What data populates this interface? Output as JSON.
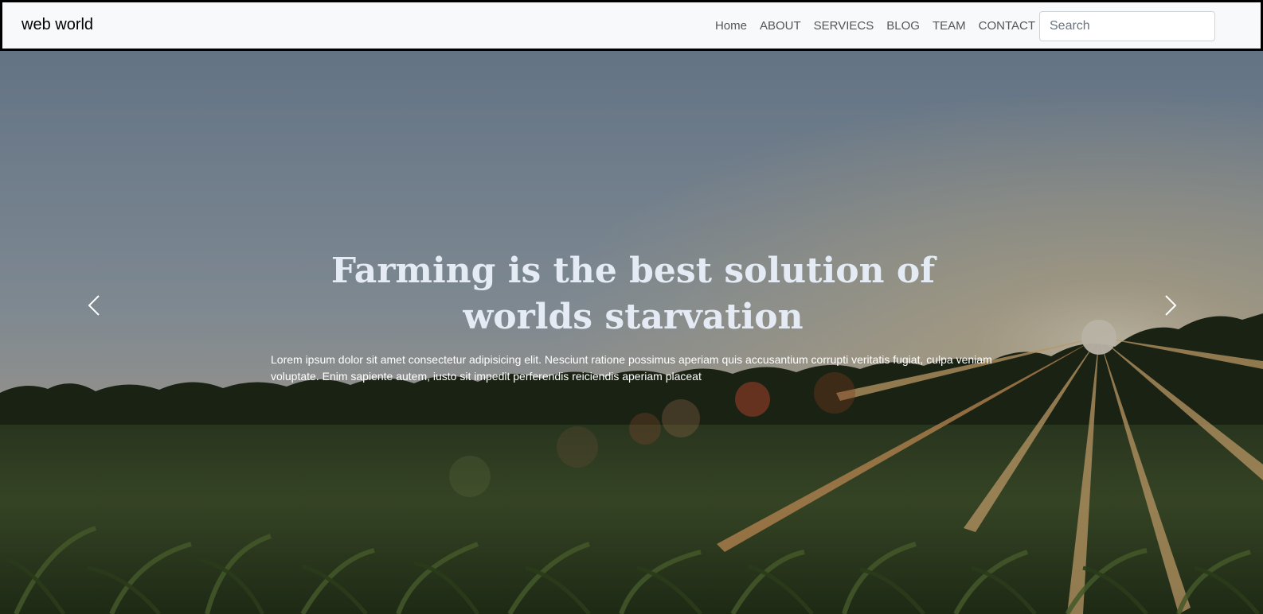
{
  "navbar": {
    "brand": "web world",
    "links": [
      "Home",
      "ABOUT",
      "SERVIECS",
      "BLOG",
      "TEAM",
      "CONTACT"
    ],
    "search_placeholder": "Search"
  },
  "hero": {
    "title": "Farming is the best solution of worlds starvation",
    "text": "Lorem ipsum dolor sit amet consectetur adipisicing elit. Nesciunt ratione possimus aperiam quis accusantium corrupti veritatis fugiat, culpa veniam voluptate. Enim sapiente autem, iusto sit impedit perferendis reiciendis aperiam placeat",
    "prev_icon": "chevron-left-icon",
    "next_icon": "chevron-right-icon",
    "background": "sunset-cornfield-photo"
  },
  "colors": {
    "navbar_bg": "#f8f9fa",
    "navbar_border": "#000000",
    "nav_link": "#555555",
    "title": "#e4ebf4"
  }
}
